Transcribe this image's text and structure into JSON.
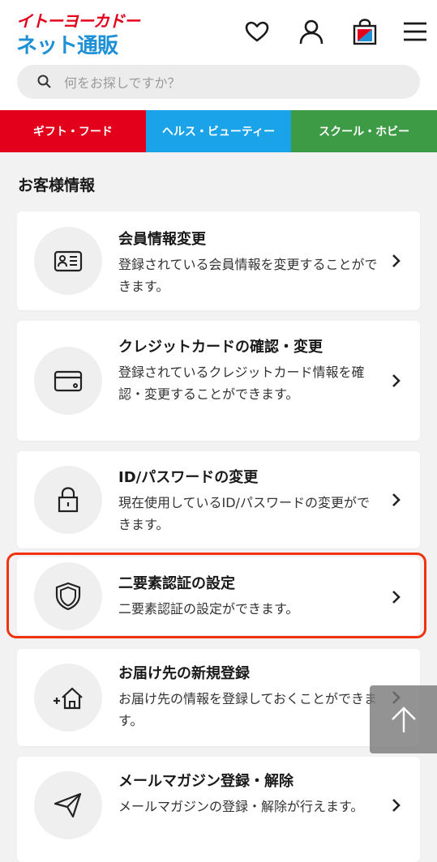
{
  "header": {
    "logo_top": "イトーヨーカドー",
    "logo_bottom": "ネット通販",
    "icons": [
      "heart-icon",
      "user-icon",
      "shopping-bag-icon",
      "menu-icon"
    ]
  },
  "search": {
    "placeholder": "何をお探しですか？"
  },
  "tabs": [
    {
      "label": "ギフト・フード",
      "color": "#e3001b"
    },
    {
      "label": "ヘルス・ビューティー",
      "color": "#1aa3e8"
    },
    {
      "label": "スクール・ホビー",
      "color": "#3d9a45"
    }
  ],
  "section": {
    "title": "お客様情報"
  },
  "cards": [
    {
      "icon": "id-card-icon",
      "title": "会員情報変更",
      "desc": "登録されている会員情報を変更することができます。"
    },
    {
      "icon": "credit-card-icon",
      "title": "クレジットカードの確認・変更",
      "desc": "登録されているクレジットカード情報を確認・変更することができます。"
    },
    {
      "icon": "lock-icon",
      "title": "ID/パスワードの変更",
      "desc": "現在使用しているID/パスワードの変更ができます。"
    },
    {
      "icon": "shield-icon",
      "title": "二要素認証の設定",
      "desc": "二要素認証の設定ができます。"
    },
    {
      "icon": "add-home-icon",
      "title": "お届け先の新規登録",
      "desc": "お届け先の情報を登録しておくことができます。"
    },
    {
      "icon": "paper-plane-icon",
      "title": "メールマガジン登録・解除",
      "desc": "メールマガジンの登録・解除が行えます。"
    }
  ],
  "colors": {
    "highlight": "#f0330f",
    "brand_red": "#e3001b",
    "brand_blue": "#1e90d6"
  }
}
